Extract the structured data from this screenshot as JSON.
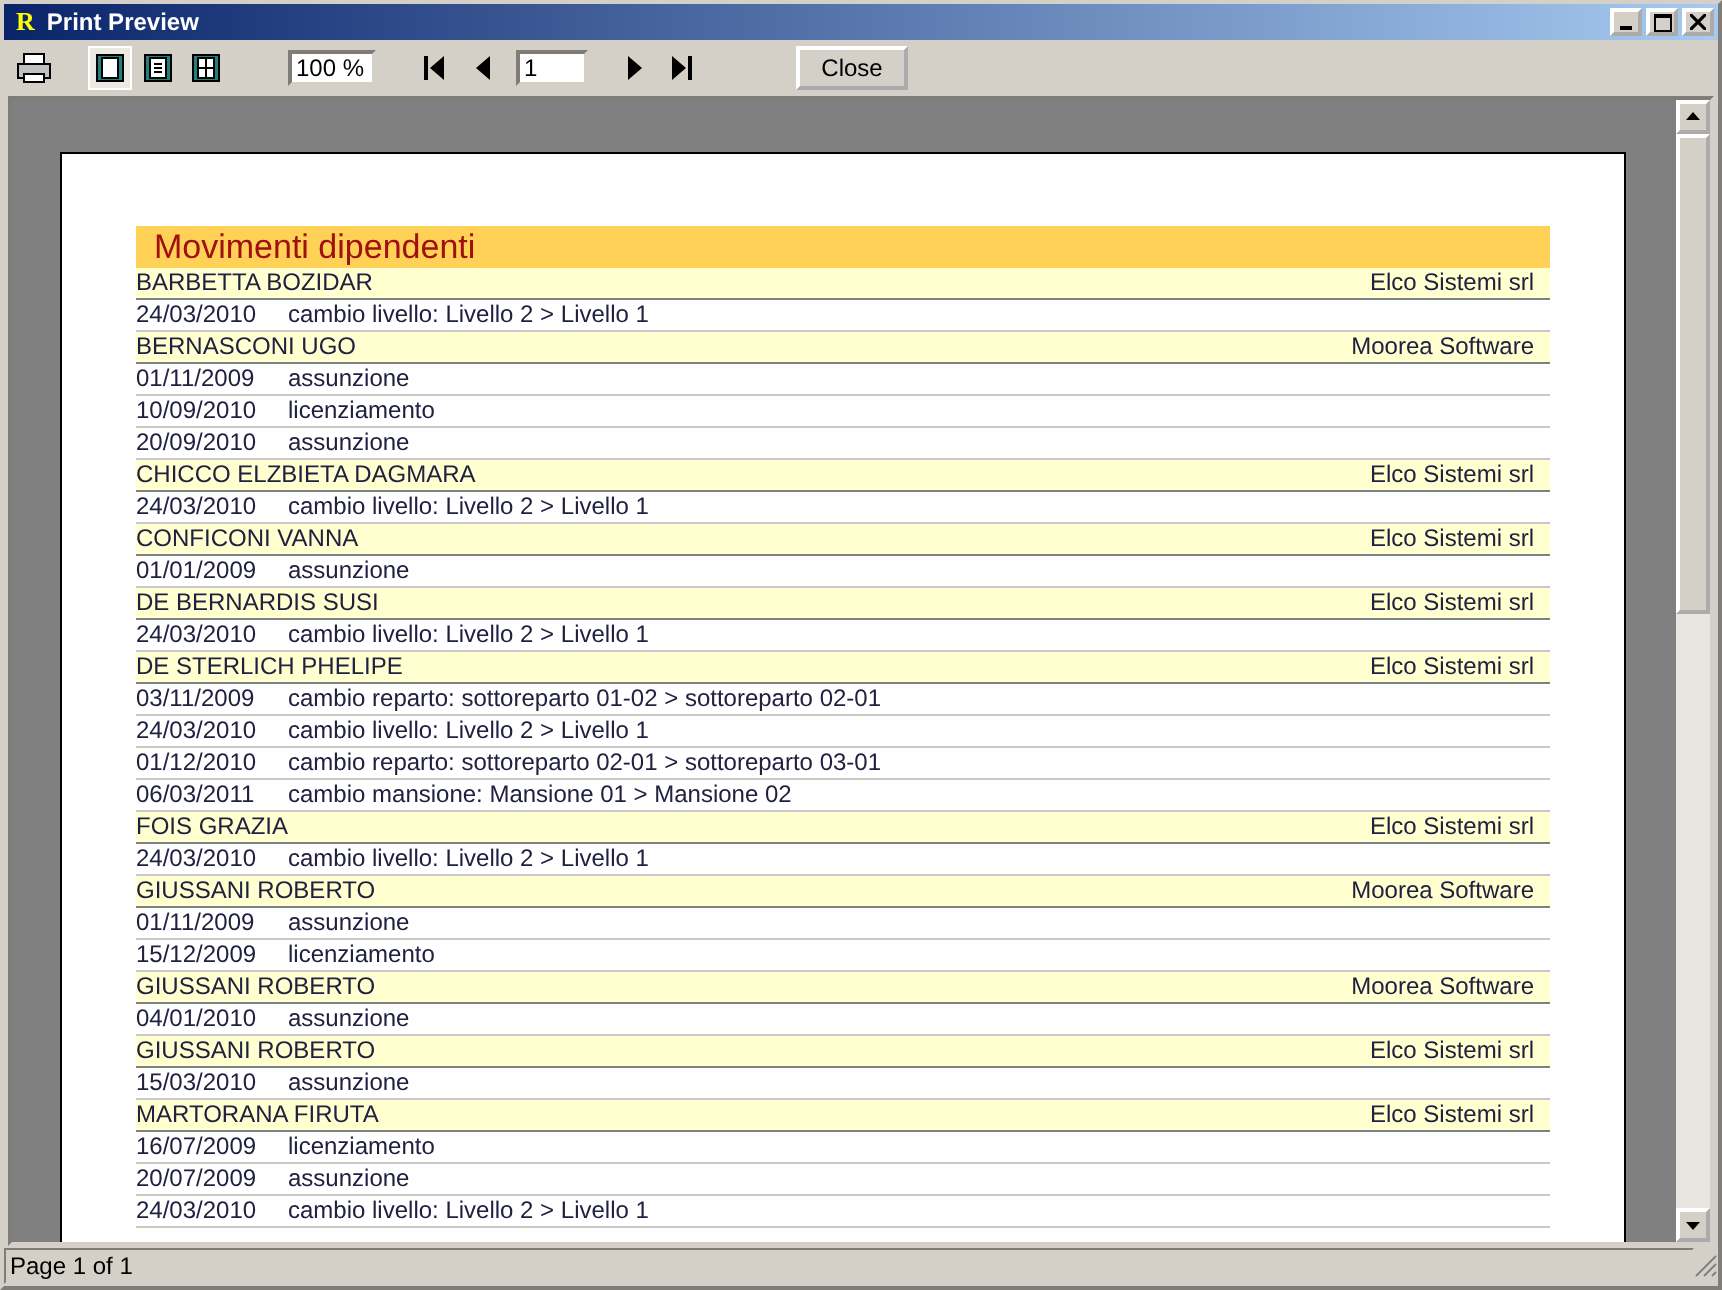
{
  "window": {
    "title": "Print Preview",
    "logo": "R"
  },
  "toolbar": {
    "view_modes": [
      {
        "selected": true
      },
      {
        "selected": false
      },
      {
        "selected": false
      }
    ],
    "zoom": "100 %",
    "page": "1",
    "close": "Close"
  },
  "report": {
    "title": "Movimenti dipendenti",
    "groups": [
      {
        "name": "BARBETTA BOZIDAR",
        "company": "Elco Sistemi srl",
        "entries": [
          {
            "date": "24/03/2010",
            "text": "cambio livello: Livello 2 > Livello 1"
          }
        ]
      },
      {
        "name": "BERNASCONI UGO",
        "company": "Moorea Software",
        "entries": [
          {
            "date": "01/11/2009",
            "text": "assunzione"
          },
          {
            "date": "10/09/2010",
            "text": "licenziamento"
          },
          {
            "date": "20/09/2010",
            "text": "assunzione"
          }
        ]
      },
      {
        "name": "CHICCO ELZBIETA DAGMARA",
        "company": "Elco Sistemi srl",
        "entries": [
          {
            "date": "24/03/2010",
            "text": "cambio livello: Livello 2 > Livello 1"
          }
        ]
      },
      {
        "name": "CONFICONI VANNA",
        "company": "Elco Sistemi srl",
        "entries": [
          {
            "date": "01/01/2009",
            "text": "assunzione"
          }
        ]
      },
      {
        "name": "DE BERNARDIS SUSI",
        "company": "Elco Sistemi srl",
        "entries": [
          {
            "date": "24/03/2010",
            "text": "cambio livello: Livello 2 > Livello 1"
          }
        ]
      },
      {
        "name": "DE STERLICH PHELIPE",
        "company": "Elco Sistemi srl",
        "entries": [
          {
            "date": "03/11/2009",
            "text": "cambio reparto: sottoreparto 01-02 > sottoreparto 02-01"
          },
          {
            "date": "24/03/2010",
            "text": "cambio livello: Livello 2 > Livello 1"
          },
          {
            "date": "01/12/2010",
            "text": "cambio reparto: sottoreparto 02-01 > sottoreparto 03-01"
          },
          {
            "date": "06/03/2011",
            "text": "cambio mansione: Mansione 01 > Mansione 02"
          }
        ]
      },
      {
        "name": "FOIS GRAZIA",
        "company": "Elco Sistemi srl",
        "entries": [
          {
            "date": "24/03/2010",
            "text": "cambio livello: Livello 2 > Livello 1"
          }
        ]
      },
      {
        "name": "GIUSSANI ROBERTO",
        "company": "Moorea Software",
        "entries": [
          {
            "date": "01/11/2009",
            "text": "assunzione"
          },
          {
            "date": "15/12/2009",
            "text": "licenziamento"
          }
        ]
      },
      {
        "name": "GIUSSANI ROBERTO",
        "company": "Moorea Software",
        "entries": [
          {
            "date": "04/01/2010",
            "text": "assunzione"
          }
        ]
      },
      {
        "name": "GIUSSANI ROBERTO",
        "company": "Elco Sistemi srl",
        "entries": [
          {
            "date": "15/03/2010",
            "text": "assunzione"
          }
        ]
      },
      {
        "name": "MARTORANA FIRUTA",
        "company": "Elco Sistemi srl",
        "entries": [
          {
            "date": "16/07/2009",
            "text": "licenziamento"
          },
          {
            "date": "20/07/2009",
            "text": "assunzione"
          },
          {
            "date": "24/03/2010",
            "text": "cambio livello: Livello 2 > Livello 1"
          }
        ]
      }
    ]
  },
  "status_bar": "Page 1 of 1"
}
